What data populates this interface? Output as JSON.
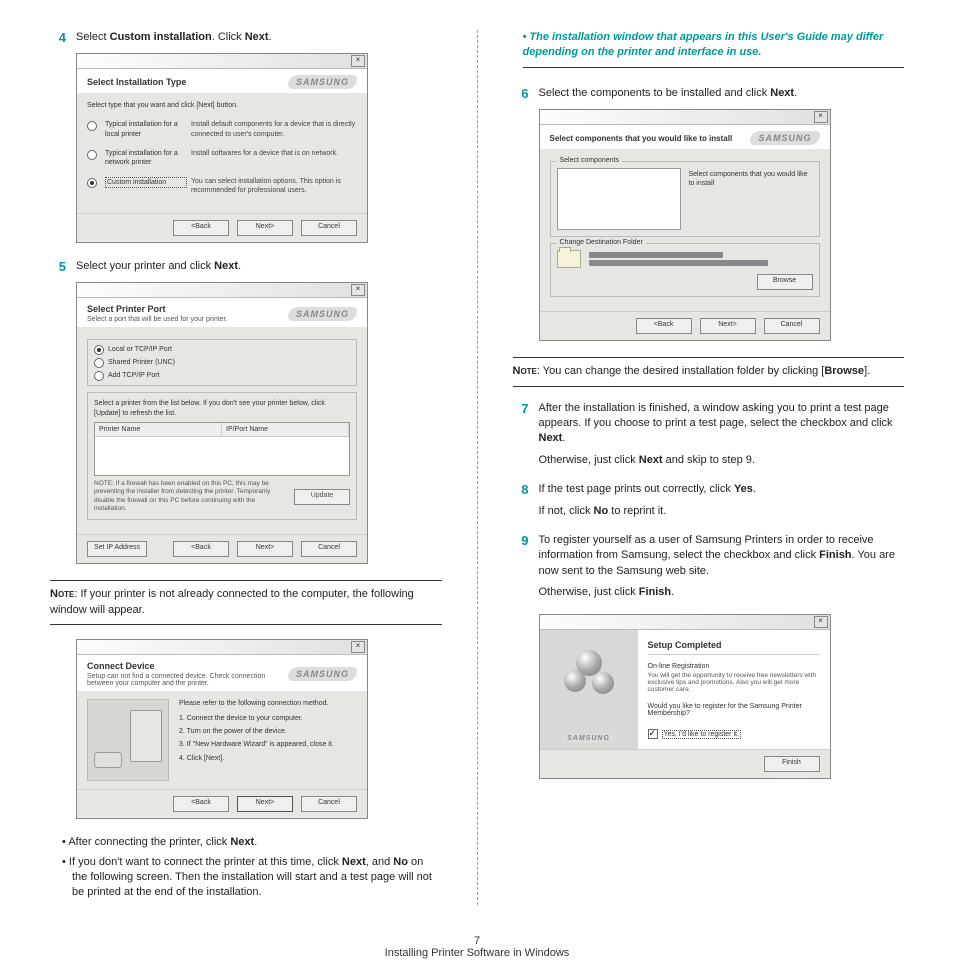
{
  "footer": {
    "page_num": "7",
    "section": "Installing Printer Software in Windows"
  },
  "left": {
    "step4": {
      "num": "4",
      "text_a": "Select ",
      "text_b": "Custom installation",
      "text_c": ". Click ",
      "text_d": "Next",
      "text_e": "."
    },
    "dlg1": {
      "title": "Select Installation Type",
      "hint": "Select type that you want and click [Next] button.",
      "opt1_label": "Typical installation for a local printer",
      "opt1_desc": "Install default components for a device that is directly connected to user's computer.",
      "opt2_label": "Typical installation for a network printer",
      "opt2_desc": "Install softwares for a device that is on network.",
      "opt3_label": "Custom installation",
      "opt3_desc": "You can select installation options. This option is recommended for professional users.",
      "btn_back": "<Back",
      "btn_next": "Next>",
      "btn_cancel": "Cancel"
    },
    "step5": {
      "num": "5",
      "text_a": "Select your printer and click ",
      "text_b": "Next",
      "text_c": "."
    },
    "dlg2": {
      "title": "Select Printer Port",
      "sub": "Select a port that will be used for your printer.",
      "r1": "Local or TCP/IP Port",
      "r2": "Shared Printer (UNC)",
      "r3": "Add TCP/IP Port",
      "list_hint": "Select a printer from the list below. If you don't see your printer below, click [Update] to refresh the list.",
      "col1": "Printer Name",
      "col2": "IP/Port Name",
      "fw_note": "NOTE: If a firewall has been enabled on this PC, this may be preventing the installer from detecting the printer. Temporarily disable the firewall on this PC before continuing with the installation.",
      "btn_update": "Update",
      "btn_setip": "Set IP Address",
      "btn_back": "<Back",
      "btn_next": "Next>",
      "btn_cancel": "Cancel"
    },
    "note1": {
      "label": "Note",
      "text": ": If your printer is not already connected to the computer, the following window will appear."
    },
    "dlg3": {
      "title": "Connect Device",
      "sub": "Setup can not find a connected device. Check connection between your computer and the printer.",
      "intro": "Please refer to the following connection method.",
      "s1": "1. Connect the device to your computer.",
      "s2": "2. Turn on the power of the device.",
      "s3": "3. If \"New Hardware Wizard\" is appeared, close it.",
      "s4": "4. Click [Next].",
      "btn_back": "<Back",
      "btn_next": "Next>",
      "btn_cancel": "Cancel"
    },
    "b1": {
      "a": "After connecting the printer, click ",
      "b": "Next",
      "c": "."
    },
    "b2": {
      "a": "If you don't want to connect the printer at this time, click ",
      "b": "Next",
      "c": ", and ",
      "d": "No",
      "e": " on the following screen. Then the installation will start and a test page will not be printed at the end of the installation."
    }
  },
  "right": {
    "teal": "The installation window that appears in this User's Guide may differ depending on the printer and interface in use.",
    "step6": {
      "num": "6",
      "a": "Select the components to be installed and click ",
      "b": "Next",
      "c": "."
    },
    "dlg4": {
      "title": "Select components that you would like to install",
      "g1": "Select components",
      "side": "Select components that you would like to install",
      "g2": "Change Destination Folder",
      "btn_browse": "Browse",
      "btn_back": "<Back",
      "btn_next": "Next>",
      "btn_cancel": "Cancel"
    },
    "note2": {
      "label": "Note",
      "a": ": You can change the desired installation folder by clicking [",
      "b": "Browse",
      "c": "]."
    },
    "step7": {
      "num": "7",
      "a": "After the installation is finished, a window asking you to print a test page appears. If you choose to print a test page, select the checkbox and click ",
      "b": "Next",
      "c": ".",
      "d": "Otherwise, just click ",
      "e": "Next",
      "f": " and skip to step 9."
    },
    "step8": {
      "num": "8",
      "a": "If the test page prints out correctly, click ",
      "b": "Yes",
      "c": ".",
      "d": "If not, click ",
      "e": "No",
      "f": " to reprint it."
    },
    "step9": {
      "num": "9",
      "a": "To register yourself as a user of Samsung Printers in order to receive information from Samsung, select the checkbox and click ",
      "b": "Finish",
      "c": ". You are now sent to the Samsung web site.",
      "d": "Otherwise, just click ",
      "e": "Finish",
      "f": "."
    },
    "dlg5": {
      "title": "Setup Completed",
      "reg_title": "On-line Registration",
      "reg_body": "You will get the opportunity to receive free newsletters with exclusive tips and promotions. Also you will get more customer care.",
      "q": "Would you like to register for the Samsung Printer Membership?",
      "opt": "Yes, I'd like to register it.",
      "btn_finish": "Finish"
    }
  },
  "brand": "SAMSUNG"
}
